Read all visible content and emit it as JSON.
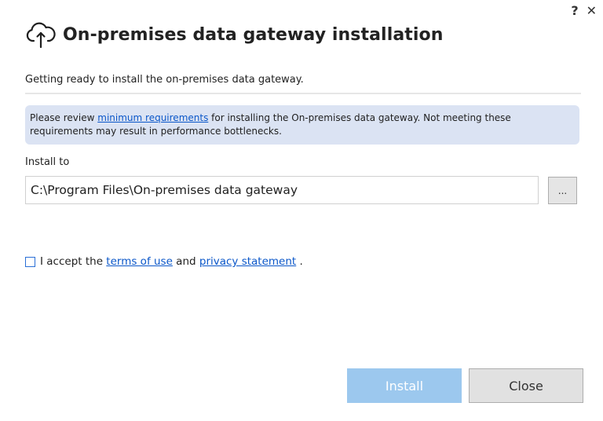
{
  "window": {
    "help_glyph": "?",
    "close_glyph": "✕"
  },
  "header": {
    "icon": "cloud-upload-icon",
    "title": "On-premises data gateway installation"
  },
  "subtitle": "Getting ready to install the on-premises data gateway.",
  "banner": {
    "prefix": "Please review ",
    "link_text": "minimum requirements",
    "suffix": " for installing the On-premises data gateway. Not meeting these requirements may result in performance bottlenecks."
  },
  "install": {
    "label": "Install to",
    "path_value": "C:\\Program Files\\On-premises data gateway",
    "browse_label": "..."
  },
  "accept": {
    "checked": false,
    "prefix": "I accept the ",
    "terms_link": "terms of use",
    "middle": " and ",
    "privacy_link": "privacy statement",
    "suffix": " ."
  },
  "buttons": {
    "install_label": "Install",
    "close_label": "Close"
  },
  "colors": {
    "accent": "#0b57c9",
    "banner_bg": "#dbe3f3",
    "install_disabled": "#9cc8ee",
    "close_bg": "#e1e1e1"
  }
}
